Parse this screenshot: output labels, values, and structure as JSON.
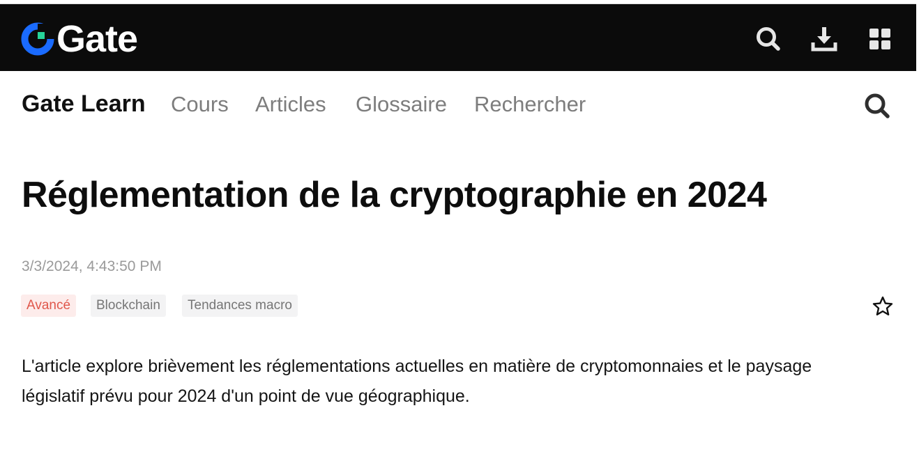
{
  "brand": {
    "logo_text": "Gate",
    "colors": {
      "logo_blue": "#1a6bff",
      "logo_green": "#27d39a",
      "topbar": "#0b0b0b"
    }
  },
  "topbar": {
    "icons": [
      "search-icon",
      "download-icon",
      "apps-grid-icon"
    ]
  },
  "nav": {
    "brand": "Gate Learn",
    "links": [
      "Cours",
      "Articles",
      "Glossaire",
      "Rechercher"
    ],
    "search_icon": "search-icon"
  },
  "article": {
    "title": "Réglementation de la cryptographie en 2024",
    "date": "3/3/2024, 4:43:50 PM",
    "tags": [
      "Avancé",
      "Blockchain",
      "Tendances macro"
    ],
    "summary": "L'article explore brièvement les réglementations actuelles en matière de cryptomonnaies et le paysage législatif prévu pour 2024 d'un point de vue géographique.",
    "favorite_icon": "star-icon",
    "colors": {
      "tag_advanced_text": "#e0574b",
      "tag_advanced_bg": "#fdeceb"
    }
  }
}
